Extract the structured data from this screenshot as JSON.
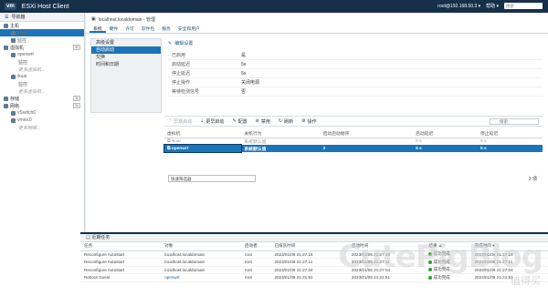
{
  "topbar": {
    "logo": "vm",
    "title": "ESXi Host Client",
    "user": "root@192.168.50.3 ▾",
    "help": "帮助 ▾",
    "search_placeholder": "搜索"
  },
  "nav": {
    "header": "导航器",
    "items": [
      {
        "label": "主机",
        "level": 0
      },
      {
        "label": "管理",
        "level": 1,
        "selected": true
      },
      {
        "label": "监控",
        "level": 1
      },
      {
        "label": "虚拟机",
        "level": 0,
        "badge": "2"
      },
      {
        "label": "openwrt",
        "level": 1
      },
      {
        "label": "监控",
        "level": 2
      },
      {
        "label": "更多虚拟机...",
        "level": 2,
        "muted": true
      },
      {
        "label": "ikuai",
        "level": 1
      },
      {
        "label": "监控",
        "level": 2
      },
      {
        "label": "更多虚拟机...",
        "level": 2,
        "muted": true
      },
      {
        "label": "存储",
        "level": 0,
        "badge": "1"
      },
      {
        "label": "网络",
        "level": 0,
        "badge": "1"
      },
      {
        "label": "vSwitch0",
        "level": 1
      },
      {
        "label": "vmnic0",
        "level": 1
      },
      {
        "label": "更多网络...",
        "level": 2,
        "muted": true
      }
    ]
  },
  "main": {
    "host_title": "localhost.localdomain - 管理",
    "tabs": [
      "系统",
      "硬件",
      "许可",
      "软件包",
      "服务",
      "安全和用户"
    ],
    "side_items": [
      "高级设置",
      "自动启动",
      "交换",
      "时间和日期"
    ],
    "edit_link": "编辑设置",
    "props": [
      {
        "k": "已启用",
        "v": "是"
      },
      {
        "k": "启动延迟",
        "v": "5s"
      },
      {
        "k": "停止延迟",
        "v": "5s"
      },
      {
        "k": "停止操作",
        "v": "关闭电源"
      },
      {
        "k": "等待检测信号",
        "v": "否"
      }
    ],
    "toolbar": {
      "earlier": "早期启动",
      "later": "更早启动",
      "config": "配置",
      "disable": "禁用",
      "refresh": "刷新",
      "actions": "操作",
      "search_placeholder": "搜索"
    },
    "table": {
      "headers": [
        "虚拟机",
        "关机行为",
        "启动启动顺序",
        "启动延迟",
        "停止延迟"
      ],
      "rows": [
        {
          "name": "ikuai",
          "shutdown": "系统默认值",
          "order": "",
          "delay": "5 s",
          "stop": "5 s",
          "selected": false
        },
        {
          "name": "openwrt",
          "shutdown": "系统默认值",
          "order": "2",
          "delay": "5 s",
          "stop": "5 s",
          "selected": true
        }
      ]
    },
    "filter_placeholder": "快速筛选器",
    "count": "2 项"
  },
  "tasks": {
    "title": "近期任务",
    "headers": [
      "任务",
      "对象",
      "启动者",
      "已排队时间",
      "启动时间",
      "结果 ▲",
      "完成时间 ▾"
    ],
    "rows": [
      {
        "task": "Reconfigure Autostart",
        "target": "localhost.localdomain",
        "initiator": "root",
        "queued": "2023/01/06 21:27:18",
        "started": "2023/01/06 21:27:18",
        "result": "成功完成",
        "done": "2023/01/06 21:27:18"
      },
      {
        "task": "Reconfigure Autostart",
        "target": "localhost.localdomain",
        "initiator": "root",
        "queued": "2023/01/06 21:27:11",
        "started": "2023/01/06 21:27:11",
        "result": "成功完成",
        "done": "2023/01/06 21:27:11"
      },
      {
        "task": "Reconfigure Autostart",
        "target": "localhost.localdomain",
        "initiator": "root",
        "queued": "2023/01/06 21:27:04",
        "started": "2023/01/06 21:27:04",
        "result": "成功完成",
        "done": "2023/01/06 21:27:04"
      },
      {
        "task": "Reboot Guest",
        "target": "openwrt",
        "initiator": "root",
        "queued": "2023/01/06 21:21:51",
        "started": "2023/01/06 21:21:51",
        "result": "成功完成",
        "done": "2023/01/06 21:21:51"
      }
    ]
  },
  "watermark": {
    "text": "CutePigBlog",
    "sub": "值得买"
  }
}
